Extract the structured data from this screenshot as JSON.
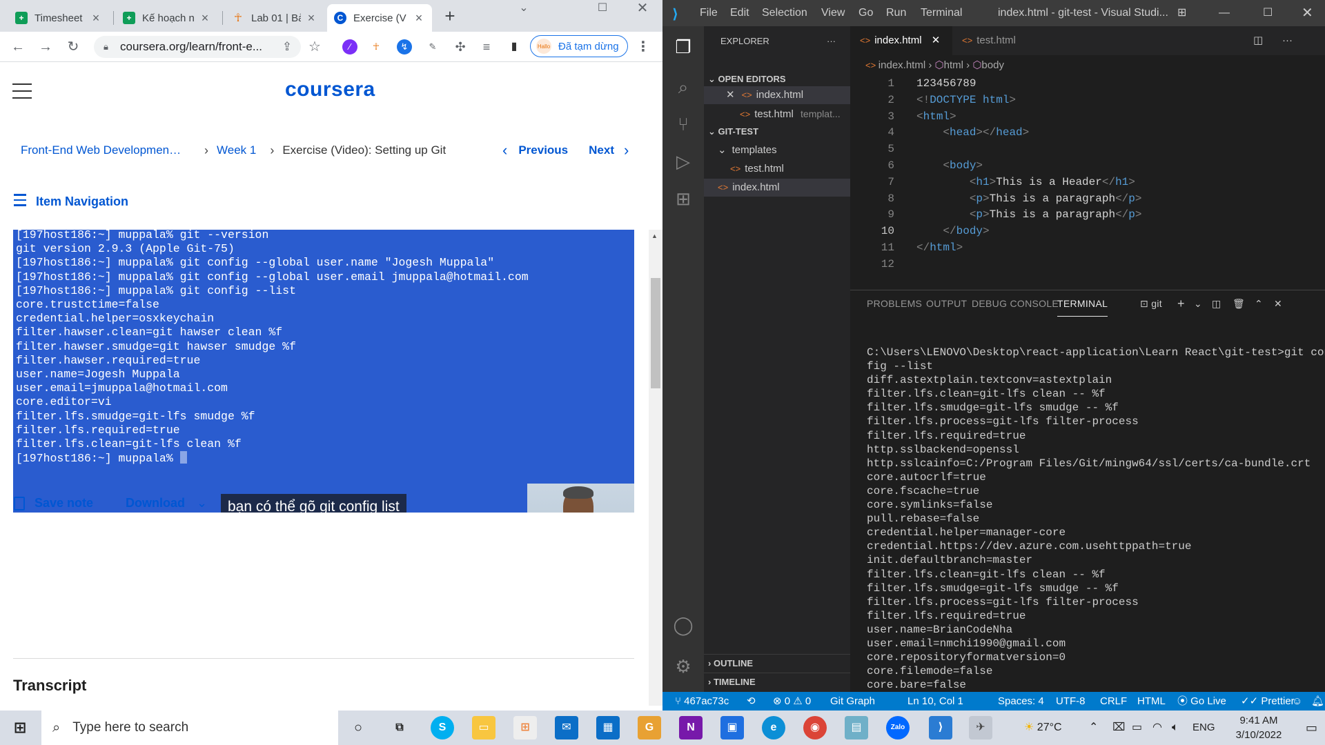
{
  "browser": {
    "tabs": [
      {
        "title": "Timesheet",
        "icon": "sheets-icon"
      },
      {
        "title": "Kế hoạch n",
        "icon": "sheets-icon"
      },
      {
        "title": "Lab 01 | Bả",
        "icon": "person-icon"
      },
      {
        "title": "Exercise (V",
        "icon": "coursera-icon"
      }
    ],
    "url": "coursera.org/learn/front-e...",
    "paused_label": "Đã tạm dừng",
    "paused_badge": "Hallo"
  },
  "coursera": {
    "logo": "coursera",
    "breadcrumb": {
      "course": "Front-End Web Development ...",
      "week": "Week 1",
      "item": "Exercise (Video): Setting up Git"
    },
    "previous_label": "Previous",
    "next_label": "Next",
    "item_navigation": "Item Navigation",
    "video_terminal_lines": [
      "[197host186:~] muppala% git --version",
      "git version 2.9.3 (Apple Git-75)",
      "[197host186:~] muppala% git config --global user.name \"Jogesh Muppala\"",
      "[197host186:~] muppala% git config --global user.email jmuppala@hotmail.com",
      "[197host186:~] muppala% git config --list",
      "core.trustctime=false",
      "credential.helper=osxkeychain",
      "filter.hawser.clean=git hawser clean %f",
      "filter.hawser.smudge=git hawser smudge %f",
      "filter.hawser.required=true",
      "user.name=Jogesh Muppala",
      "user.email=jmuppala@hotmail.com",
      "core.editor=vi",
      "filter.lfs.smudge=git-lfs smudge %f",
      "filter.lfs.required=true",
      "filter.lfs.clean=git-lfs clean %f",
      "[197host186:~] muppala% "
    ],
    "caption": "bạn có thể gõ git config list",
    "save_note": "Save note",
    "download": "Download",
    "transcript": "Transcript"
  },
  "vscode": {
    "menu": [
      "File",
      "Edit",
      "Selection",
      "View",
      "Go",
      "Run",
      "Terminal"
    ],
    "window_title": "index.html - git-test - Visual Studi...",
    "explorer_title": "EXPLORER",
    "open_editors_label": "OPEN EDITORS",
    "open_editors": [
      {
        "name": "index.html",
        "detail": ""
      },
      {
        "name": "test.html",
        "detail": "templat..."
      }
    ],
    "folder_label": "GIT-TEST",
    "tree": [
      {
        "name": "templates",
        "type": "folder"
      },
      {
        "name": "test.html",
        "type": "file"
      },
      {
        "name": "index.html",
        "type": "file"
      }
    ],
    "outline_label": "OUTLINE",
    "timeline_label": "TIMELINE",
    "editor_tabs": [
      "index.html",
      "test.html"
    ],
    "breadcrumb": [
      "index.html",
      "html",
      "body"
    ],
    "code_lines": [
      {
        "n": "1",
        "text": "123456789"
      },
      {
        "n": "2",
        "text": "<!DOCTYPE html>"
      },
      {
        "n": "3",
        "text": "<html>"
      },
      {
        "n": "4",
        "text": "    <head></head>"
      },
      {
        "n": "5",
        "text": ""
      },
      {
        "n": "6",
        "text": "    <body>"
      },
      {
        "n": "7",
        "text": "        <h1>This is a Header</h1>"
      },
      {
        "n": "8",
        "text": "        <p>This is a paragraph</p>"
      },
      {
        "n": "9",
        "text": "        <p>This is a paragraph</p>"
      },
      {
        "n": "10",
        "text": "    </body>"
      },
      {
        "n": "11",
        "text": "</html>"
      },
      {
        "n": "12",
        "text": ""
      }
    ],
    "panel_tabs": [
      "PROBLEMS",
      "OUTPUT",
      "DEBUG CONSOLE",
      "TERMINAL"
    ],
    "terminal_name": "git",
    "terminal_lines": [
      "C:\\Users\\LENOVO\\Desktop\\react-application\\Learn React\\git-test>git con",
      "fig --list",
      "diff.astextplain.textconv=astextplain",
      "filter.lfs.clean=git-lfs clean -- %f",
      "filter.lfs.smudge=git-lfs smudge -- %f",
      "filter.lfs.process=git-lfs filter-process",
      "filter.lfs.required=true",
      "http.sslbackend=openssl",
      "http.sslcainfo=C:/Program Files/Git/mingw64/ssl/certs/ca-bundle.crt",
      "core.autocrlf=true",
      "core.fscache=true",
      "core.symlinks=false",
      "pull.rebase=false",
      "credential.helper=manager-core",
      "credential.https://dev.azure.com.usehttppath=true",
      "init.defaultbranch=master",
      "filter.lfs.clean=git-lfs clean -- %f",
      "filter.lfs.smudge=git-lfs smudge -- %f",
      "filter.lfs.process=git-lfs filter-process",
      "filter.lfs.required=true",
      "user.name=BrianCodeNha",
      "user.email=nmchi1990@gmail.com",
      "core.repositoryformatversion=0",
      "core.filemode=false",
      "core.bare=false"
    ],
    "status": {
      "branch": "467ac73c",
      "errors": "0",
      "warnings": "0",
      "git_graph": "Git Graph",
      "position": "Ln 10, Col 1",
      "spaces": "Spaces: 4",
      "encoding": "UTF-8",
      "eol": "CRLF",
      "language": "HTML",
      "go_live": "Go Live",
      "prettier": "Prettier"
    }
  },
  "taskbar": {
    "search_placeholder": "Type here to search",
    "weather": "27°C",
    "language": "ENG",
    "time": "9:41 AM",
    "date": "3/10/2022"
  }
}
